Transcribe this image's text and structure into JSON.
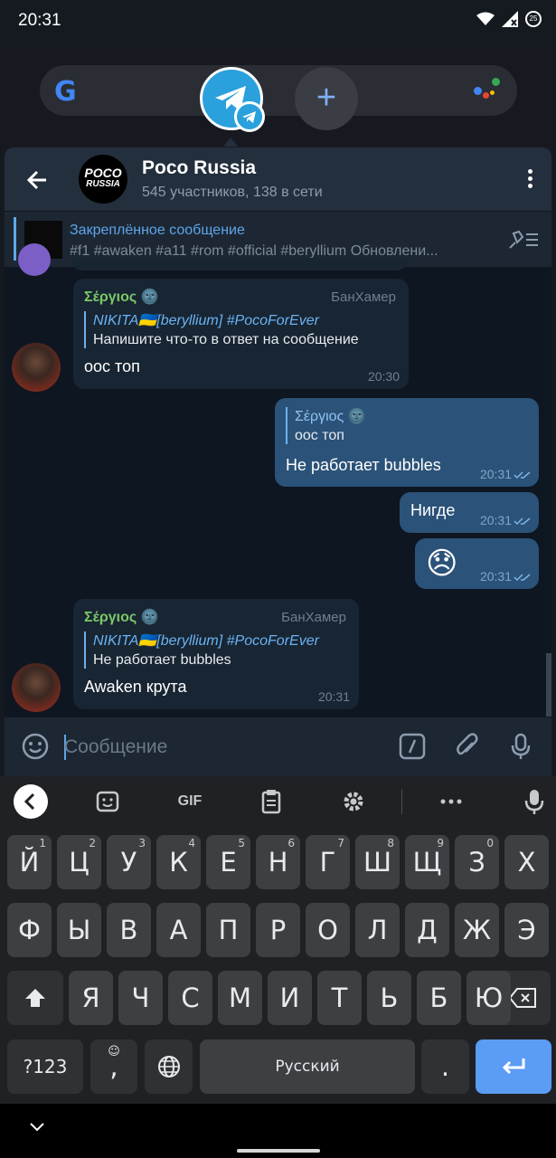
{
  "status_bar": {
    "time": "20:31",
    "battery": "25"
  },
  "chat": {
    "title": "Poco Russia",
    "subtitle": "545 участников, 138 в сети",
    "avatar_line1": "POCO",
    "avatar_line2": "RUSSIA",
    "pinned": {
      "title": "Закреплённое сообщение",
      "text": "#f1 #awaken #a11 #rom #official #beryllium Обновлени..."
    },
    "messages": [
      {
        "sender": "Σέργιος",
        "admin_title": "БанХамер",
        "reply_name": "NIKITA🇺🇦[beryllium] #PocoForEver",
        "reply_text": "Напишите что-то в ответ на сообщение",
        "text": "оос топ",
        "time": "20:30"
      },
      {
        "reply_name": "Σέργιος",
        "reply_text": "оос топ",
        "text": "Не работает bubbles",
        "time": "20:31"
      },
      {
        "text": "Нигде",
        "time": "20:31"
      },
      {
        "text": "😞",
        "time": "20:31"
      },
      {
        "sender": "Σέργιος",
        "admin_title": "БанХамер",
        "reply_name": "NIKITA🇺🇦[beryllium] #PocoForEver",
        "reply_text": "Не работает bubbles",
        "text": "Awaken крута",
        "time": "20:31"
      }
    ],
    "input_placeholder": "Сообщение"
  },
  "keyboard": {
    "toolbar_gif": "GIF",
    "row1": [
      {
        "k": "Й",
        "h": "1"
      },
      {
        "k": "Ц",
        "h": "2"
      },
      {
        "k": "У",
        "h": "3"
      },
      {
        "k": "К",
        "h": "4"
      },
      {
        "k": "Е",
        "h": "5"
      },
      {
        "k": "Н",
        "h": "6"
      },
      {
        "k": "Г",
        "h": "7"
      },
      {
        "k": "Ш",
        "h": "8"
      },
      {
        "k": "Щ",
        "h": "9"
      },
      {
        "k": "З",
        "h": "0"
      },
      {
        "k": "Х",
        "h": ""
      }
    ],
    "row2": [
      "Ф",
      "Ы",
      "В",
      "А",
      "П",
      "Р",
      "О",
      "Л",
      "Д",
      "Ж",
      "Э"
    ],
    "row3": [
      "Я",
      "Ч",
      "С",
      "М",
      "И",
      "Т",
      "Ь",
      "Б",
      "Ю"
    ],
    "symbols_key": "?123",
    "comma_key": ",",
    "space_label": "Русский",
    "period_key": "."
  },
  "colors": {
    "accent": "#5ea5ea",
    "sender_green": "#7cc866",
    "outgoing_bubble": "#2b5278",
    "incoming_bubble": "#182533",
    "enter_key": "#5b9cf5"
  }
}
